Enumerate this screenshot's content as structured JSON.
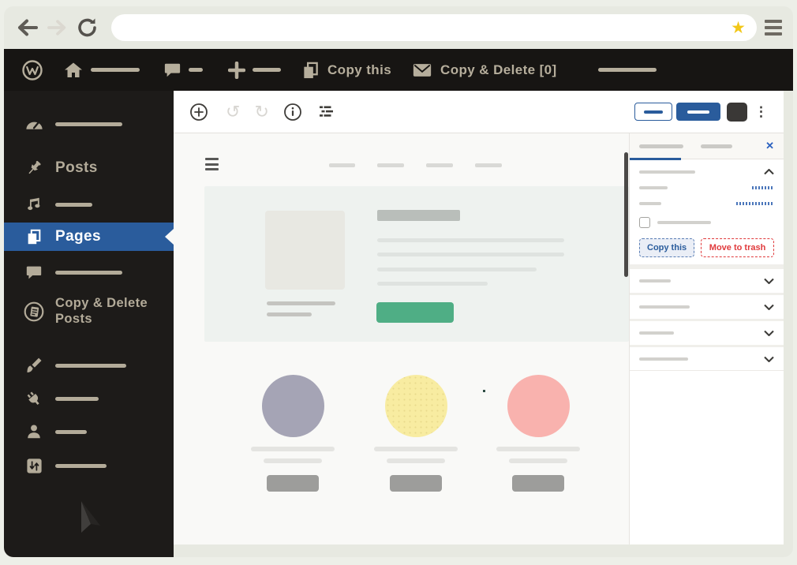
{
  "browser": {
    "back_icon": "arrow-left",
    "forward_icon": "arrow-right",
    "refresh_icon": "refresh",
    "url_value": "",
    "bookmark_icon": "star",
    "menu_icon": "hamburger-menu",
    "bookmark_glyph": "★",
    "star_color": "#f2c718"
  },
  "admin_bar": {
    "wordpress_icon": "wordpress-logo",
    "home_icon": "home",
    "comments_icon": "speech-bubble",
    "new_icon": "plus",
    "copy_this_label": "Copy this",
    "copy_this_icon": "copy-pages",
    "copy_delete_label": "Copy & Delete [0]",
    "copy_delete_icon": "envelope",
    "bar_color": "#171513",
    "icon_color": "#b6ae9c"
  },
  "sidebar": {
    "active_item": "Pages",
    "items": [
      {
        "name": "dashboard",
        "icon": "gauge-icon",
        "label": ""
      },
      {
        "name": "posts",
        "icon": "pushpin-icon",
        "label": "Posts"
      },
      {
        "name": "media",
        "icon": "music-notes-icon",
        "label": ""
      },
      {
        "name": "pages",
        "icon": "pages-icon",
        "label": "Pages"
      },
      {
        "name": "comments",
        "icon": "comment-icon",
        "label": ""
      },
      {
        "name": "copy-delete-posts",
        "icon": "document-circle-icon",
        "label": "Copy & Delete Posts"
      },
      {
        "name": "appearance",
        "icon": "paintbrush-icon",
        "label": ""
      },
      {
        "name": "plugins",
        "icon": "plug-icon",
        "label": ""
      },
      {
        "name": "users",
        "icon": "user-icon",
        "label": ""
      },
      {
        "name": "settings",
        "icon": "sliders-icon",
        "label": ""
      }
    ],
    "active_color": "#2a5c9c"
  },
  "editor_toolbar": {
    "inserter_icon": "circle-plus",
    "undo_icon": "undo-arrow",
    "redo_icon": "redo-arrow",
    "info_icon": "circle-info",
    "list_view_icon": "list-view",
    "more_icon": "kebab-menu",
    "kebab_glyph": "⋮",
    "undo_glyph": "↺",
    "redo_glyph": "↻"
  },
  "panel": {
    "close_icon": "close-x",
    "close_glyph": "✕",
    "copy_button_label": "Copy this",
    "trash_button_label": "Move to trash"
  },
  "canvas": {
    "hero_button_color": "#4fae85",
    "circle_colors": [
      "#a5a4b5",
      "#f8eca1",
      "#f9b2ae"
    ]
  },
  "colors": {
    "accent_blue": "#2a5c9c",
    "danger_red": "#e03a3c",
    "frame": "#e7e9e1",
    "dark_ui": "#1d1b19"
  },
  "cursor_icon": "mouse-pointer"
}
